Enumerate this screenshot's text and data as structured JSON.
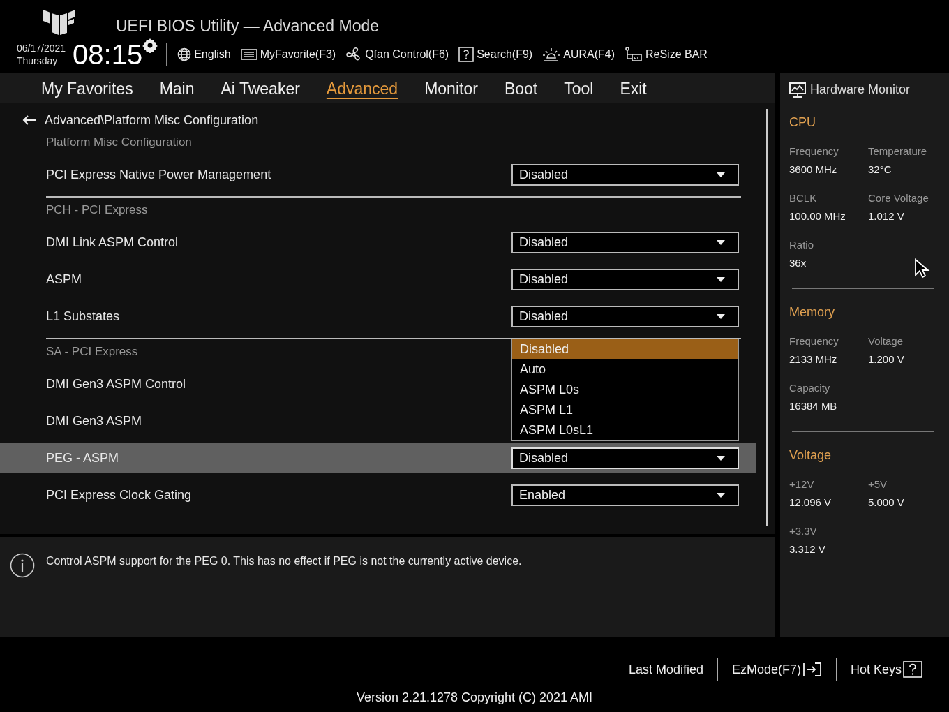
{
  "header": {
    "title": "UEFI BIOS Utility — Advanced Mode",
    "date": "06/17/2021",
    "day": "Thursday",
    "time": "08:15",
    "tools": [
      {
        "kind": "language",
        "label": "English"
      },
      {
        "kind": "favorite",
        "label": "MyFavorite(F3)"
      },
      {
        "kind": "fan",
        "label": "Qfan Control(F6)"
      },
      {
        "kind": "search",
        "label": "Search(F9)"
      },
      {
        "kind": "aura",
        "label": "AURA(F4)"
      },
      {
        "kind": "rebar",
        "label": "ReSize BAR"
      }
    ]
  },
  "tabs": [
    {
      "label": "My Favorites",
      "selected": false
    },
    {
      "label": "Main",
      "selected": false
    },
    {
      "label": "Ai Tweaker",
      "selected": false
    },
    {
      "label": "Advanced",
      "selected": true
    },
    {
      "label": "Monitor",
      "selected": false
    },
    {
      "label": "Boot",
      "selected": false
    },
    {
      "label": "Tool",
      "selected": false
    },
    {
      "label": "Exit",
      "selected": false
    }
  ],
  "breadcrumb": "Advanced\\Platform Misc Configuration",
  "sections": [
    {
      "title": "Platform Misc Configuration",
      "items": [
        {
          "label": "PCI Express Native Power Management",
          "value": "Disabled",
          "selected": false
        }
      ]
    },
    {
      "title": "PCH - PCI Express",
      "items": [
        {
          "label": "DMI Link ASPM Control",
          "value": "Disabled",
          "selected": false
        },
        {
          "label": "ASPM",
          "value": "Disabled",
          "selected": false
        },
        {
          "label": "L1 Substates",
          "value": "Disabled",
          "selected": false
        }
      ]
    },
    {
      "title": "SA - PCI Express",
      "items": [
        {
          "label": "DMI Gen3 ASPM Control",
          "selected": false
        },
        {
          "label": "DMI Gen3 ASPM",
          "selected": false
        },
        {
          "label": "PEG - ASPM",
          "value": "Disabled",
          "selected": true,
          "options": [
            {
              "label": "Disabled",
              "selected": true
            },
            {
              "label": "Auto",
              "selected": false
            },
            {
              "label": "ASPM L0s",
              "selected": false
            },
            {
              "label": "ASPM L1",
              "selected": false
            },
            {
              "label": "ASPM L0sL1",
              "selected": false
            }
          ]
        },
        {
          "label": "PCI Express Clock Gating",
          "value": "Enabled",
          "selected": false
        }
      ]
    }
  ],
  "help": "Control ASPM support for the PEG 0.  This has no effect if PEG is not the currently active device.",
  "monitor": {
    "title": "Hardware Monitor",
    "sections": [
      {
        "title": "CPU",
        "metrics": [
          {
            "label": "Frequency",
            "value": "3600 MHz"
          },
          {
            "label": "Temperature",
            "value": "32°C"
          },
          {
            "label": "BCLK",
            "value": "100.00 MHz"
          },
          {
            "label": "Core Voltage",
            "value": "1.012 V"
          },
          {
            "label": "Ratio",
            "value": "36x"
          }
        ]
      },
      {
        "title": "Memory",
        "metrics": [
          {
            "label": "Frequency",
            "value": "2133 MHz"
          },
          {
            "label": "Voltage",
            "value": "1.200 V"
          },
          {
            "label": "Capacity",
            "value": "16384 MB"
          }
        ]
      },
      {
        "title": "Voltage",
        "metrics": [
          {
            "label": "+12V",
            "value": "12.096 V"
          },
          {
            "label": "+5V",
            "value": "5.000 V"
          },
          {
            "label": "+3.3V",
            "value": "3.312 V"
          }
        ]
      }
    ]
  },
  "footer": {
    "actions": [
      {
        "kind": "text",
        "label": "Last Modified"
      },
      {
        "kind": "ezmode",
        "label": "EzMode(F7)"
      },
      {
        "kind": "hotkeys",
        "label": "Hot Keys"
      }
    ],
    "version": "Version 2.21.1278 Copyright (C) 2021 AMI"
  }
}
